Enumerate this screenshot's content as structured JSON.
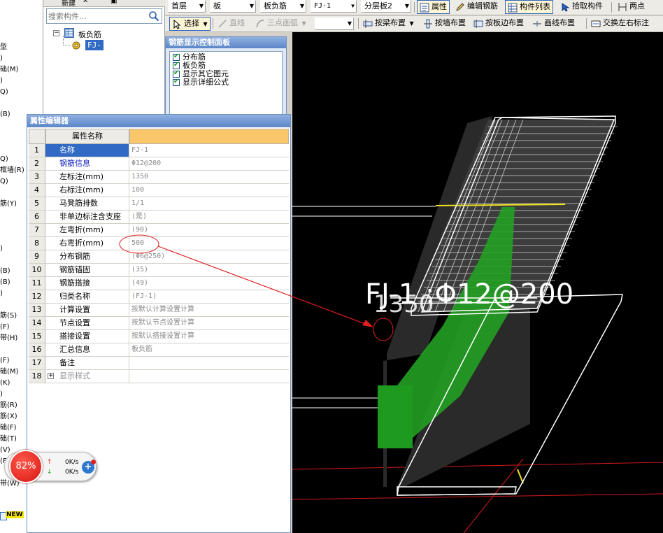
{
  "left_sidebar": {
    "items": [
      "型",
      ")",
      "础(M)",
      ")",
      "Q)",
      "(B)",
      "Q)",
      "框墙(R)",
      "Q)",
      "筋(Y)",
      ")",
      "(B)",
      "(B)",
      ")",
      "筋(S)",
      "(F)",
      "带(H)",
      "(F)",
      "础(M)",
      "(K)",
      ")",
      "筋(R)",
      "筋(X)",
      "础(F)",
      "础(T)",
      "(V)",
      "(F)",
      "带(W)"
    ],
    "new_badge": "NEW"
  },
  "tree_panel": {
    "toolbar_items": [
      "新建",
      "✕",
      "▣"
    ],
    "search_placeholder": "搜索构件...",
    "root_label": "板负筋",
    "child_label": "FJ-1"
  },
  "toolbar_1": {
    "floor": "首层",
    "category": "板",
    "component_type": "板负筋",
    "component": "FJ-1",
    "layer": "分层板2",
    "btn_property": "属性",
    "btn_edit_rebar": "编辑钢筋",
    "btn_component_list": "构件列表",
    "btn_pick": "拾取构件",
    "btn_two_points": "两点"
  },
  "toolbar_2": {
    "btn_select": "选择",
    "btn_line": "直线",
    "btn_arc": "三点画弧",
    "btn_beam": "按梁布置",
    "btn_wall": "按墙布置",
    "btn_slab_edge": "按板边布置",
    "btn_draw_line": "画线布置",
    "btn_swap": "交换左右标注"
  },
  "rebar_panel": {
    "title": "钢筋显示控制面板",
    "options": [
      {
        "label": "分布筋",
        "checked": true
      },
      {
        "label": "板负筋",
        "checked": true
      },
      {
        "label": "显示其它图元",
        "checked": true
      },
      {
        "label": "显示详细公式",
        "checked": true
      }
    ]
  },
  "property_editor": {
    "title": "属性编辑器",
    "header_name": "属性名称",
    "rows": [
      {
        "num": "1",
        "name": "名称",
        "value": "FJ-1",
        "style": "selected"
      },
      {
        "num": "2",
        "name": "钢筋信息",
        "value": "Φ12@200",
        "style": "blue"
      },
      {
        "num": "3",
        "name": "左标注(mm)",
        "value": "1350",
        "style": ""
      },
      {
        "num": "4",
        "name": "右标注(mm)",
        "value": "100",
        "style": ""
      },
      {
        "num": "5",
        "name": "马凳筋排数",
        "value": "1/1",
        "style": ""
      },
      {
        "num": "6",
        "name": "非单边标注含支座",
        "value": "(是)",
        "style": ""
      },
      {
        "num": "7",
        "name": "左弯折(mm)",
        "value": "(90)",
        "style": ""
      },
      {
        "num": "8",
        "name": "右弯折(mm)",
        "value": "500",
        "style": ""
      },
      {
        "num": "9",
        "name": "分布钢筋",
        "value": "(Φ6@250)",
        "style": ""
      },
      {
        "num": "10",
        "name": "钢筋锚固",
        "value": "(35)",
        "style": ""
      },
      {
        "num": "11",
        "name": "钢筋搭接",
        "value": "(49)",
        "style": ""
      },
      {
        "num": "12",
        "name": "归类名称",
        "value": "(FJ-1)",
        "style": ""
      },
      {
        "num": "13",
        "name": "计算设置",
        "value": "按默认计算设置计算",
        "style": ""
      },
      {
        "num": "14",
        "name": "节点设置",
        "value": "按默认节点设置计算",
        "style": ""
      },
      {
        "num": "15",
        "name": "搭接设置",
        "value": "按默认搭接设置计算",
        "style": ""
      },
      {
        "num": "16",
        "name": "汇总信息",
        "value": "板负筋",
        "style": ""
      },
      {
        "num": "17",
        "name": "备注",
        "value": "",
        "style": ""
      },
      {
        "num": "18",
        "name": "显示样式",
        "value": "",
        "style": "grey-expand"
      }
    ]
  },
  "viewport": {
    "label_main": "FJ-1 :Φ12@200",
    "label_overlap": "1350"
  },
  "net_widget": {
    "cpu_percent": "82%",
    "up_speed": "0K/s",
    "down_speed": "0K/s",
    "btn_label": "+"
  },
  "colors": {
    "selection": "#316ac5",
    "title_bar": "#5c86c8",
    "header_value": "#f9c66a",
    "viewport_bg": "#000000",
    "rebar_green": "#22a022",
    "annotation_red": "#e02020"
  }
}
